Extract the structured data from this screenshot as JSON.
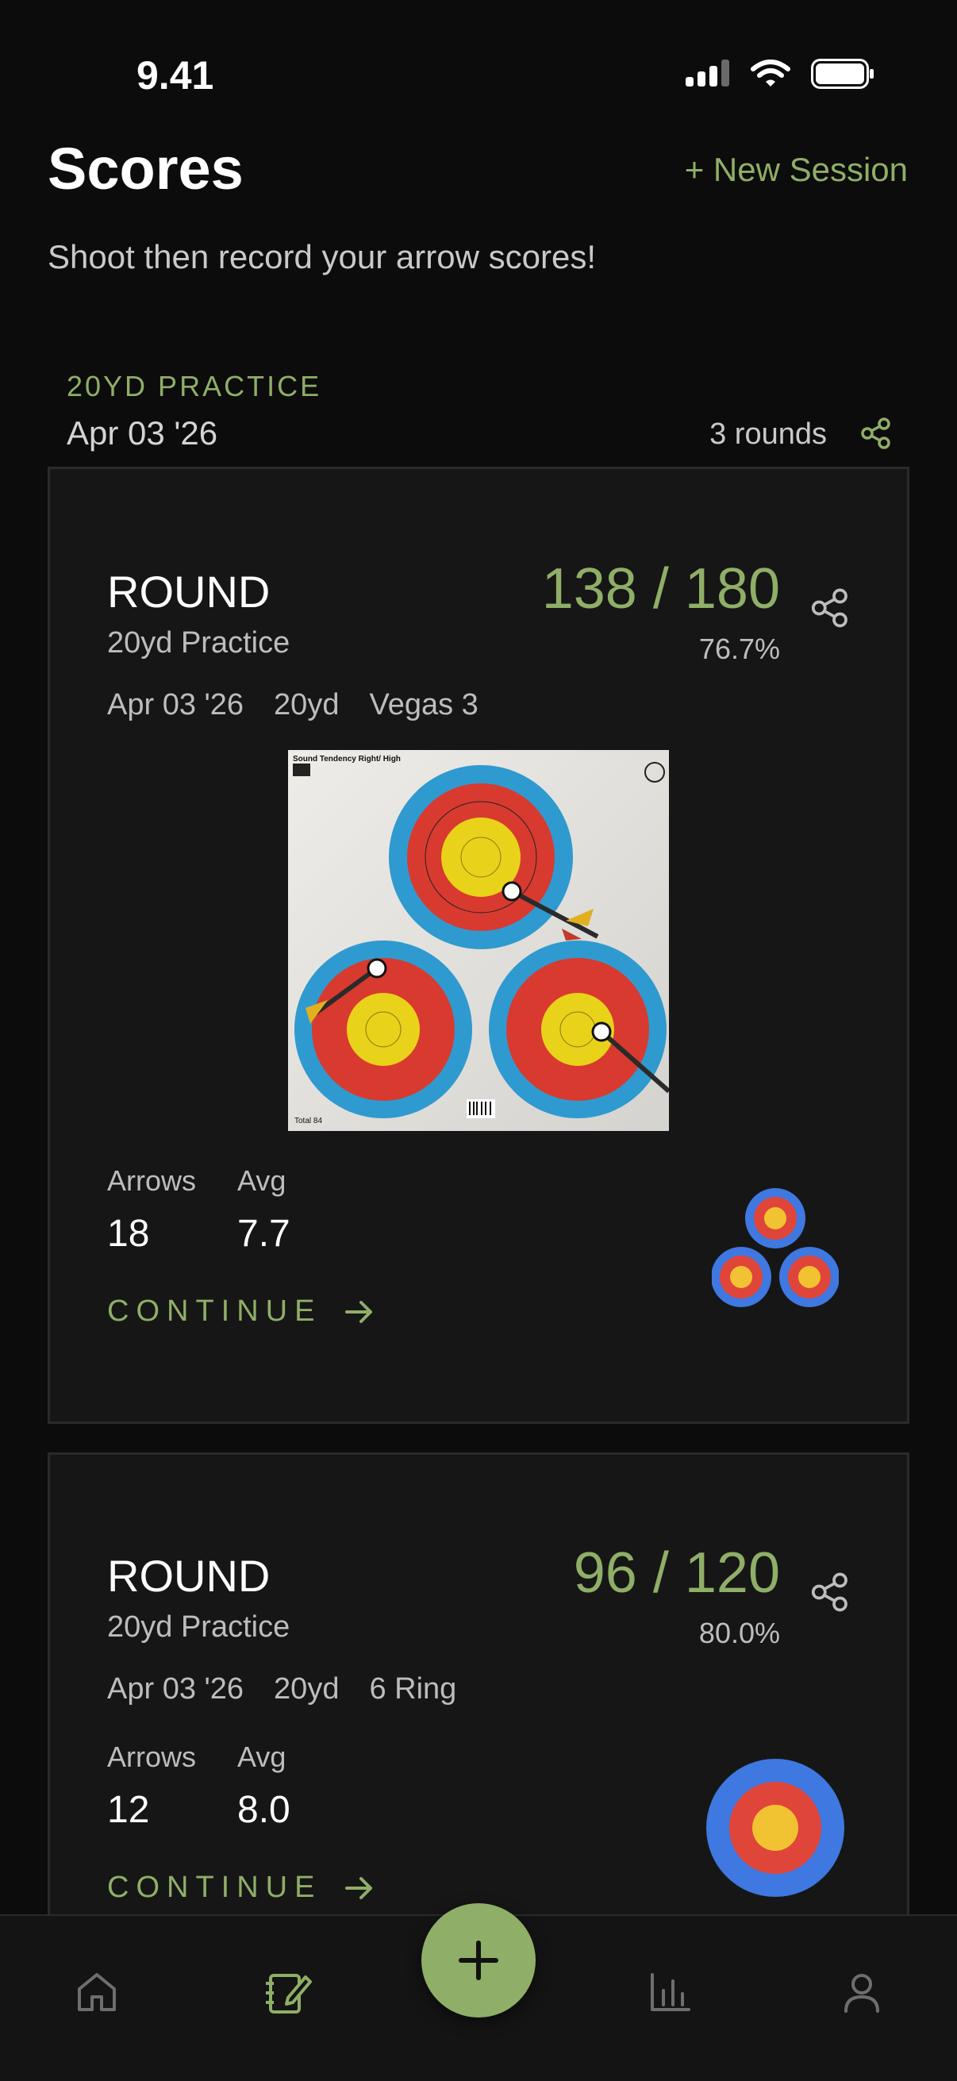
{
  "status_bar": {
    "time": "9.41"
  },
  "header": {
    "title": "Scores",
    "new_session_label": "+ New Session",
    "subtitle": "Shoot then record your arrow scores!"
  },
  "session": {
    "label": "20YD PRACTICE",
    "date": "Apr 03 '26",
    "rounds": "3 rounds"
  },
  "rounds": [
    {
      "title": "ROUND",
      "subtitle": "20yd Practice",
      "date": "Apr 03 '26",
      "distance": "20yd",
      "face": "Vegas 3",
      "score": "138 / 180",
      "percent": "76.7%",
      "arrows_label": "Arrows",
      "arrows": "18",
      "avg_label": "Avg",
      "avg": "7.7",
      "continue_label": "CONTINUE",
      "photo_text": {
        "header": "Sound Tendency Right/ High",
        "total": "Total 84"
      }
    },
    {
      "title": "ROUND",
      "subtitle": "20yd Practice",
      "date": "Apr 03 '26",
      "distance": "20yd",
      "face": "6 Ring",
      "score": "96 / 120",
      "percent": "80.0%",
      "arrows_label": "Arrows",
      "arrows": "12",
      "avg_label": "Avg",
      "avg": "8.0",
      "continue_label": "CONTINUE"
    }
  ],
  "nav": {
    "items": [
      "home-icon",
      "scores-icon",
      "add-icon",
      "stats-icon",
      "profile-icon"
    ],
    "active": "scores-icon"
  },
  "colors": {
    "accent": "#8fae67",
    "background": "#0c0c0c",
    "card": "#161616",
    "target_blue": "#3f78e0",
    "target_red": "#e0453a",
    "target_yellow": "#f1c232"
  }
}
